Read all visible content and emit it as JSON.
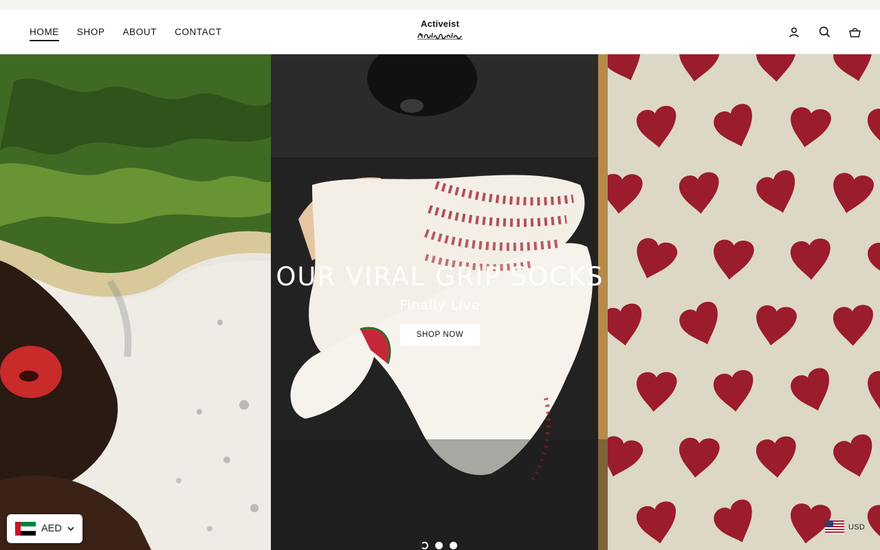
{
  "brand": {
    "logo_text": "Activeist",
    "logo_script": "Activeist"
  },
  "nav": {
    "items": [
      {
        "label": "HOME",
        "active": true
      },
      {
        "label": "SHOP",
        "active": false
      },
      {
        "label": "ABOUT",
        "active": false
      },
      {
        "label": "CONTACT",
        "active": false
      }
    ]
  },
  "header_icons": [
    "account-icon",
    "search-icon",
    "cart-icon"
  ],
  "hero": {
    "title": "OUR VIRAL GRIP SOCKS",
    "subtitle": "Finally Live",
    "cta_label": "SHOP NOW",
    "slides": 3,
    "active_slide": 1
  },
  "currency": {
    "left": {
      "code": "AED",
      "flag": "uae-flag-icon"
    },
    "right": {
      "code": "USD",
      "flag": "us-flag-icon"
    }
  },
  "colors": {
    "heart_red": "#9b1c2c",
    "hero_text": "#ffffff",
    "announcement_bg": "#f6f4f0"
  }
}
